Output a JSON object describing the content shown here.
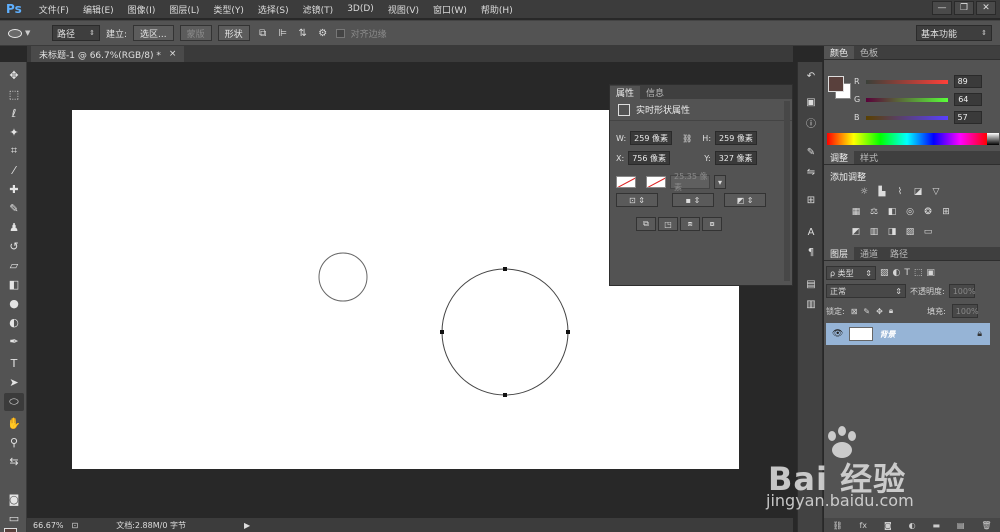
{
  "app": {
    "logo": "Ps"
  },
  "menu": [
    "文件(F)",
    "编辑(E)",
    "图像(I)",
    "图层(L)",
    "类型(Y)",
    "选择(S)",
    "滤镜(T)",
    "3D(D)",
    "视图(V)",
    "窗口(W)",
    "帮助(H)"
  ],
  "window_controls": {
    "minimize": "—",
    "restore": "❐",
    "close": "✕"
  },
  "options": {
    "mode_select": "路径",
    "build_label": "建立:",
    "selection_btn": "选区...",
    "mask_btn": "蒙版",
    "shape_btn": "形状",
    "align_edges": "对齐边缘",
    "workspace": "基本功能"
  },
  "document": {
    "tab_title": "未标题-1 @ 66.7%(RGB/8) *",
    "close": "×"
  },
  "status": {
    "zoom": "66.67%",
    "doc_info": "文档:2.88M/0 字节"
  },
  "properties_panel": {
    "tabs": [
      "属性",
      "信息"
    ],
    "title": "实时形状属性",
    "w_label": "W:",
    "w_value": "259 像素",
    "h_label": "H:",
    "h_value": "259 像素",
    "x_label": "X:",
    "x_value": "756 像素",
    "y_label": "Y:",
    "y_value": "327 像素",
    "stroke_width": "25.35 像素"
  },
  "color_panel": {
    "tabs": [
      "颜色",
      "色板"
    ],
    "fg_color": "#59403c",
    "r_label": "R",
    "r_value": "89",
    "g_label": "G",
    "g_value": "64",
    "b_label": "B",
    "b_value": "57"
  },
  "adjust_panel": {
    "tabs": [
      "调整",
      "样式"
    ],
    "title": "添加调整"
  },
  "layers_panel": {
    "tabs": [
      "图层",
      "通道",
      "路径"
    ],
    "filter": "ρ 类型",
    "blend_mode": "正常",
    "opacity_label": "不透明度:",
    "opacity_value": "100%",
    "lock_label": "锁定:",
    "fill_label": "填充:",
    "fill_value": "100%",
    "layer_name": "背景"
  },
  "watermark": {
    "brand": "Bai  经验",
    "url": "jingyan.baidu.com"
  }
}
